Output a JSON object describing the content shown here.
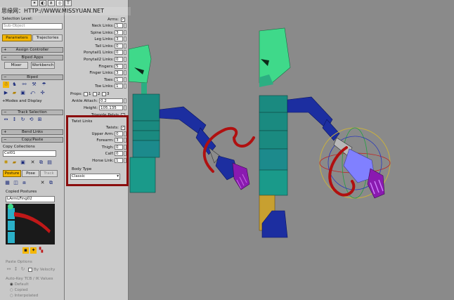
{
  "watermark": "思缘网：HTTP://WWW.MISSYUAN.NET",
  "panel": {
    "selection_level_label": "Selection Level:",
    "selection_level_value": "Sub-Object",
    "tab_parameters": "Parameters",
    "tab_trajectories": "Trajectories",
    "rollout_assign_controller": "Assign Controller",
    "rollout_biped_apps": "Biped Apps",
    "btn_mixer": "Mixer",
    "btn_workbench": "Workbench",
    "rollout_biped": "Biped",
    "modes_and_display": "Modes and Display",
    "rollout_track_selection": "Track Selection",
    "rollout_bend_links": "Bend Links",
    "rollout_copy_paste": "Copy/Paste",
    "copy_collections_label": "Copy Collections",
    "copy_collections_value": "Col01",
    "btn_posture": "Posture",
    "btn_pose": "Pose",
    "btn_track": "Track",
    "copied_postures_label": "Copied Postures",
    "copied_postures_value": "LArmLFing02",
    "paste_options_label": "Paste Options",
    "by_velocity_label": "By Velocity",
    "autokey_label": "Auto-Key TCB / IK Values",
    "radio_default": "Default",
    "radio_copied": "Copied",
    "radio_interpolated": "Interpolated"
  },
  "structure": {
    "arms_label": "Arms:",
    "arms_checked": true,
    "params": [
      {
        "label": "Neck Links:",
        "value": "1"
      },
      {
        "label": "Spine Links:",
        "value": "3"
      },
      {
        "label": "Leg Links:",
        "value": "3"
      },
      {
        "label": "Tail Links:",
        "value": "0"
      },
      {
        "label": "Ponytail1 Links:",
        "value": "0"
      },
      {
        "label": "Ponytail2 Links:",
        "value": "0"
      },
      {
        "label": "Fingers:",
        "value": "5"
      },
      {
        "label": "Finger Links:",
        "value": "3"
      },
      {
        "label": "Toes:",
        "value": "1"
      },
      {
        "label": "Toe Links:",
        "value": "1"
      }
    ],
    "props_label": "Props:",
    "props_options": [
      "1",
      "2",
      "3"
    ],
    "ankle_attach_label": "Ankle Attach:",
    "ankle_attach_value": "0.2",
    "height_label": "Height:",
    "height_value": "105.135",
    "triangle_pelvis_label": "Triangle Pelvis",
    "twist_links_label": "Twist Links",
    "twists_label": "Twists:",
    "twists_checked": true,
    "twist_params": [
      {
        "label": "Upper Arm:",
        "value": "0"
      },
      {
        "label": "Forearm:",
        "value": "3"
      },
      {
        "label": "Thigh:",
        "value": "0"
      },
      {
        "label": "Calf:",
        "value": "0"
      },
      {
        "label": "Horse Link:",
        "value": "1"
      }
    ],
    "body_type_label": "Body Type",
    "body_type_value": "Classic"
  },
  "colors": {
    "selected_tab": "#f5b700",
    "highlight_frame": "#8b0d0d",
    "head": "#3fd98a",
    "torso": "#1a8a80",
    "arm": "#1c2ea0",
    "fingers": "#8a1ab0",
    "selected_hand": "#8080ff",
    "foot": "#c8a030",
    "stroke": "#b01010"
  }
}
